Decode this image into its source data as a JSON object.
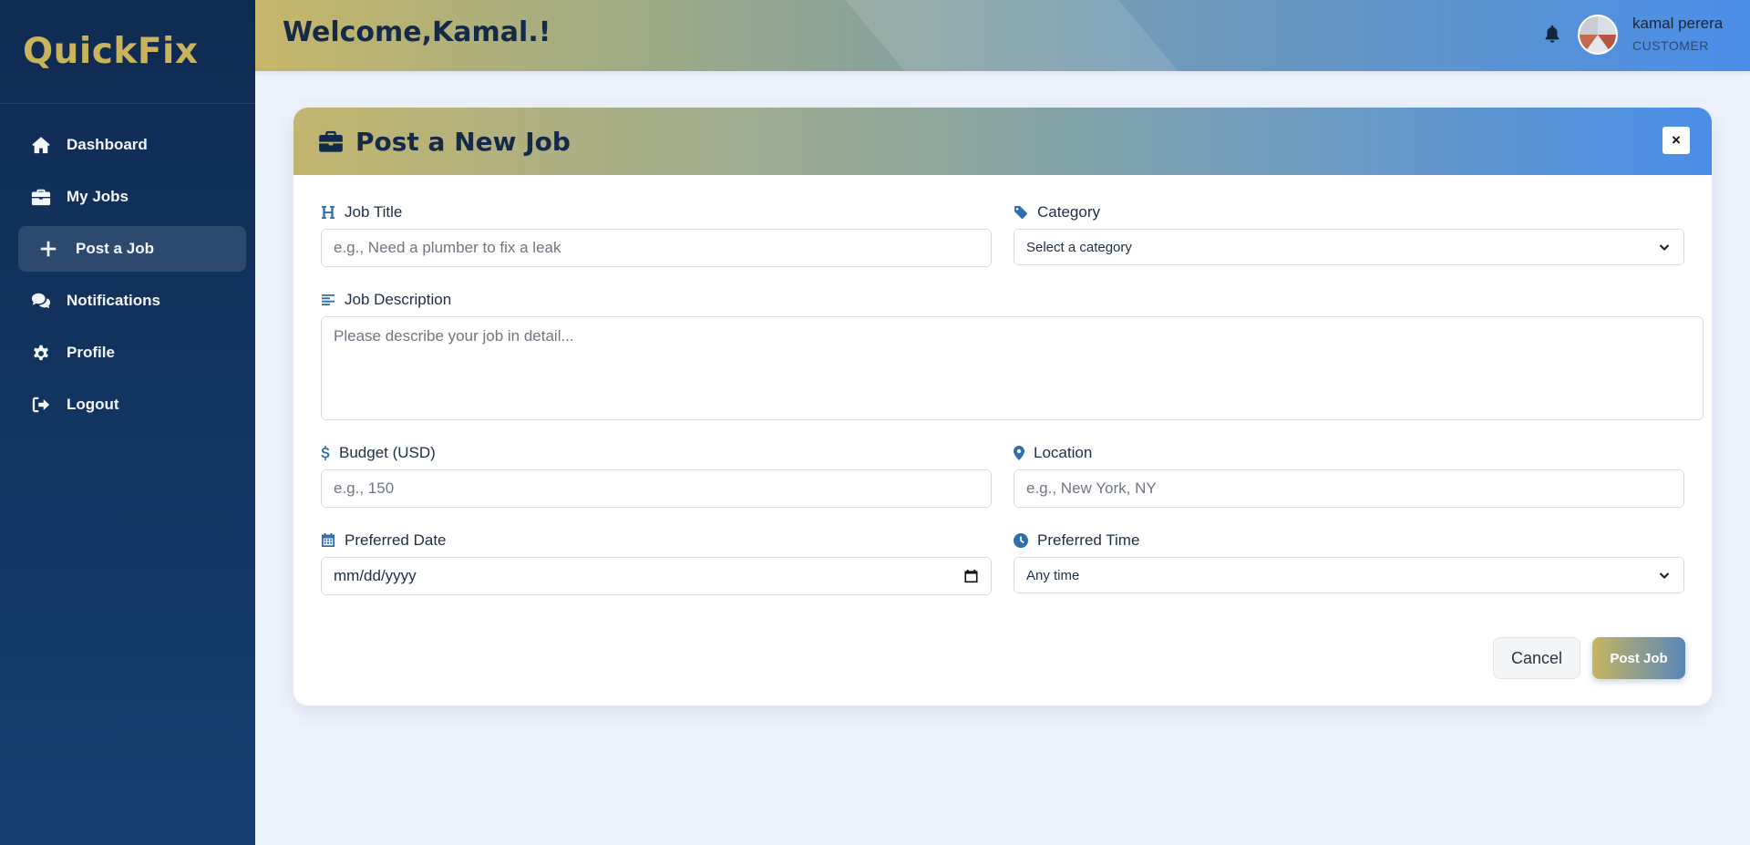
{
  "brand": "QuickFix",
  "sidebar": {
    "items": [
      {
        "label": "Dashboard",
        "icon": "home-icon"
      },
      {
        "label": "My Jobs",
        "icon": "briefcase-icon"
      },
      {
        "label": "Post a Job",
        "icon": "plus-icon",
        "active": true
      },
      {
        "label": "Notifications",
        "icon": "comments-icon"
      },
      {
        "label": "Profile",
        "icon": "gear-icon"
      },
      {
        "label": "Logout",
        "icon": "logout-icon"
      }
    ]
  },
  "header": {
    "welcome": "Welcome,Kamal.!",
    "user_name": "kamal perera",
    "user_role": "CUSTOMER"
  },
  "form": {
    "title": "Post a New Job",
    "close_label": "×",
    "job_title": {
      "label": "Job Title",
      "placeholder": "e.g., Need a plumber to fix a leak",
      "value": ""
    },
    "category": {
      "label": "Category",
      "selected": "Select a category"
    },
    "description": {
      "label": "Job Description",
      "placeholder": "Please describe your job in detail...",
      "value": ""
    },
    "budget": {
      "label": "Budget (USD)",
      "placeholder": "e.g., 150",
      "value": ""
    },
    "location": {
      "label": "Location",
      "placeholder": "e.g., New York, NY",
      "value": ""
    },
    "preferred_date": {
      "label": "Preferred Date",
      "value": "mm/dd/yyyy"
    },
    "preferred_time": {
      "label": "Preferred Time",
      "selected": "Any time"
    },
    "cancel_label": "Cancel",
    "submit_label": "Post Job"
  },
  "colors": {
    "brand": "#c9b35c",
    "sidebar": "#0f2b52",
    "accent_blue": "#4a8ee8",
    "icon_blue": "#2f6fb0"
  }
}
